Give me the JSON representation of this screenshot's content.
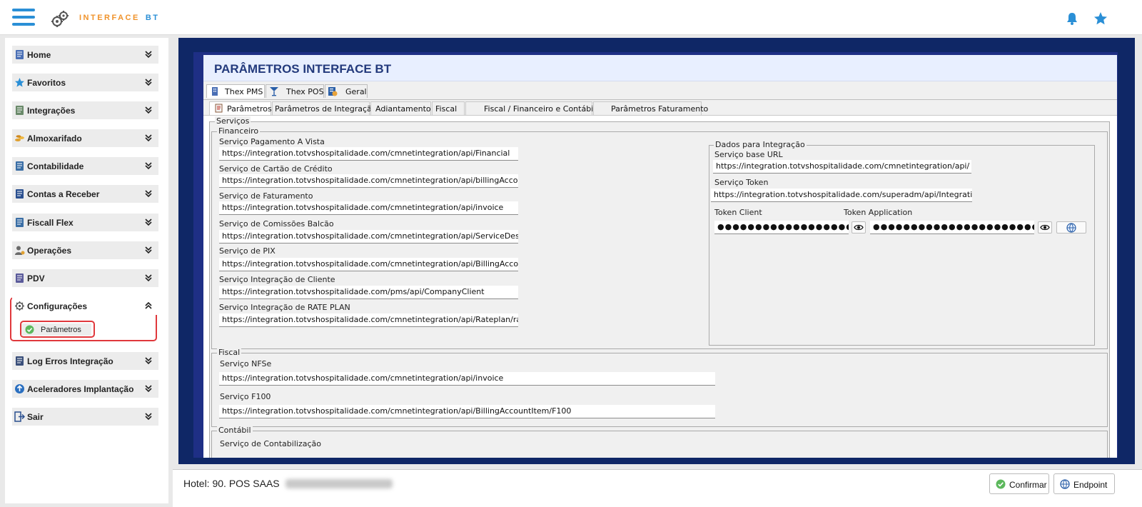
{
  "app": {
    "logo_main": "INTERFACE",
    "logo_accent": "BT"
  },
  "sidebar": {
    "items": [
      {
        "label": "Home",
        "icon": "building-icon"
      },
      {
        "label": "Favoritos",
        "icon": "star-icon"
      },
      {
        "label": "Integrações",
        "icon": "table-icon"
      },
      {
        "label": "Almoxarifado",
        "icon": "coins-icon"
      },
      {
        "label": "Contabilidade",
        "icon": "ledger-icon"
      },
      {
        "label": "Contas a Receber",
        "icon": "book-icon"
      },
      {
        "label": "Fiscall Flex",
        "icon": "document-icon"
      },
      {
        "label": "Operações",
        "icon": "user-gear-icon"
      },
      {
        "label": "PDV",
        "icon": "cash-register-icon"
      },
      {
        "label": "Configurações",
        "icon": "gear-icon",
        "expanded": true
      },
      {
        "label": "Log Erros Integração",
        "icon": "log-icon"
      },
      {
        "label": "Aceleradores Implantação",
        "icon": "arrow-up-circle-icon"
      },
      {
        "label": "Sair",
        "icon": "exit-icon"
      }
    ],
    "sub_item": {
      "label": "Parâmetros",
      "icon": "check-circle-icon"
    }
  },
  "panel": {
    "title": "PARÂMETROS INTERFACE BT",
    "tabs": [
      {
        "label": "Thex PMS",
        "icon": "building-icon",
        "active": true
      },
      {
        "label": "Thex POS",
        "icon": "cocktail-icon"
      },
      {
        "label": "Geral",
        "icon": "info-doc-icon"
      }
    ],
    "subtabs": [
      {
        "label": "Parâmetros",
        "active": true
      },
      {
        "label": "Parâmetros de Integração"
      },
      {
        "label": "Adiantamento"
      },
      {
        "label": "Fiscal"
      },
      {
        "label": "Fiscal / Financeiro e Contábil"
      },
      {
        "label": "Parâmetros Faturamento"
      }
    ]
  },
  "servicos": {
    "legend": "Serviços",
    "financeiro": {
      "legend": "Financeiro",
      "fields": [
        {
          "label": "Serviço Pagamento A Vista",
          "value": "https://integration.totvshospitalidade.com/cmnetintegration/api/Financial"
        },
        {
          "label": "Serviço de Cartão de Crédito",
          "value": "https://integration.totvshospitalidade.com/cmnetintegration/api/billingAccountIte"
        },
        {
          "label": "Serviço de Faturamento",
          "value": "https://integration.totvshospitalidade.com/cmnetintegration/api/invoice"
        },
        {
          "label": "Serviço de Comissões Balcão",
          "value": "https://integration.totvshospitalidade.com/cmnetintegration/api/ServiceDeskComis"
        },
        {
          "label": "Serviço de PIX",
          "value": "https://integration.totvshospitalidade.com/cmnetintegration/api/BillingAccountIte"
        },
        {
          "label": "Serviço Integração de Cliente",
          "value": "https://integration.totvshospitalidade.com/pms/api/CompanyClient"
        },
        {
          "label": "Serviço Integração de RATE PLAN",
          "value": "https://integration.totvshospitalidade.com/cmnetintegration/api/Rateplan/rateplar"
        }
      ]
    },
    "integracao": {
      "legend": "Dados para Integração",
      "base_url_label": "Serviço base URL",
      "base_url_value": "https://integration.totvshospitalidade.com/cmnetintegration/api/",
      "token_label": "Serviço Token",
      "token_value": "https://integration.totvshospitalidade.com/superadm/api/IntegrationPa",
      "token_client_label": "Token Client",
      "token_client_value": "●●●●●●●●●●●●●●●●●●●●●●●●●●●●●●●●●",
      "token_app_label": "Token Application",
      "token_app_value": "●●●●●●●●●●●●●●●●●●●●●●●●●●●●●●●●●●●●●●●●●●●●●●●●●●"
    },
    "fiscal": {
      "legend": "Fiscal",
      "fields": [
        {
          "label": "Serviço NFSe",
          "value": "https://integration.totvshospitalidade.com/cmnetintegration/api/invoice"
        },
        {
          "label": "Serviço F100",
          "value": "https://integration.totvshospitalidade.com/cmnetintegration/api/BillingAccountItem/F100"
        }
      ]
    },
    "contabil": {
      "legend": "Contábil",
      "field_label": "Serviço de Contabilização"
    }
  },
  "footer": {
    "hotel": "Hotel: 90. POS SAAS",
    "confirm_label": "Confirmar",
    "endpoint_label": "Endpoint"
  },
  "colors": {
    "accent": "#2a8fd6",
    "logo_orange": "#f0932b",
    "frame_navy": "#0f2766",
    "title_blue": "#233a7c",
    "highlight_red": "#e0383c"
  }
}
